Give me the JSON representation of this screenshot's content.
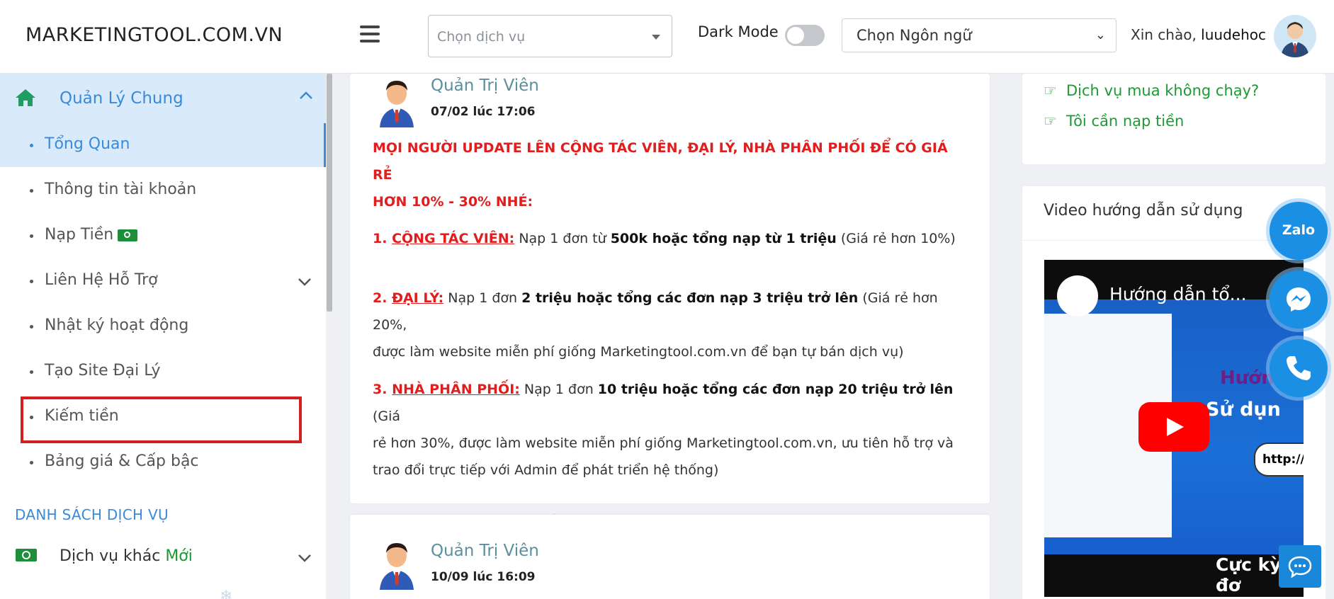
{
  "header": {
    "brand": "MARKETINGTOOL.COM.VN",
    "service_placeholder": "Chọn dịch vụ",
    "dark_mode_label": "Dark Mode",
    "language_value": "Chọn Ngôn ngữ",
    "greeting_prefix": "Xin chào,",
    "username": "luudehoc"
  },
  "sidebar": {
    "group_label": "Quản Lý Chung",
    "items": [
      {
        "label": "Tổng Quan"
      },
      {
        "label": "Thông tin tài khoản"
      },
      {
        "label": "Nạp Tiền"
      },
      {
        "label": "Liên Hệ Hỗ Trợ"
      },
      {
        "label": "Nhật ký hoạt động"
      },
      {
        "label": "Tạo Site Đại Lý"
      },
      {
        "label": "Kiếm tiền"
      },
      {
        "label": "Bảng giá & Cấp bậc"
      }
    ],
    "section_title": "DANH SÁCH DỊCH VỤ",
    "service_label": "Dịch vụ khác",
    "service_badge": "Mới"
  },
  "posts": [
    {
      "author": "Quản Trị Viên",
      "time": "07/02 lúc 17:06",
      "announcement_line1": "MỌI NGƯỜI UPDATE LÊN CỘNG TÁC VIÊN, ĐẠI LÝ, NHÀ PHÂN PHỐI ĐỂ CÓ GIÁ RẺ",
      "announcement_line2": "HƠN 10% - 30% NHÉ:",
      "p1_num": "1. ",
      "p1_label": "CỘNG TÁC VIÊN:",
      "p1_text1": " Nạp 1 đơn từ ",
      "p1_bold": "500k hoặc tổng nạp từ 1 triệu",
      "p1_text2": " (Giá rẻ hơn 10%)",
      "p2_num": "2. ",
      "p2_label": "ĐẠI LÝ:",
      "p2_text1": " Nạp 1 đơn ",
      "p2_bold": "2 triệu hoặc tổng các đơn nạp 3 triệu trở lên",
      "p2_text2": " (Giá rẻ hơn 20%,",
      "p2_line2": "được làm website miễn phí giống Marketingtool.com.vn để bạn tự bán dịch vụ)",
      "p3_num": "3. ",
      "p3_label": "NHÀ PHÂN PHỐI:",
      "p3_text1": " Nạp 1 đơn ",
      "p3_bold": "10 triệu hoặc tổng các đơn nạp 20 triệu trở lên",
      "p3_text2": "  (Giá",
      "p3_line2": "rẻ hơn 30%, được làm website miễn phí giống Marketingtool.com.vn, ưu tiên hỗ trợ và",
      "p3_line3": "trao đổi trực tiếp với Admin để phát triển hệ thống)"
    },
    {
      "author": "Quản Trị Viên",
      "time": "10/09 lúc 16:09"
    }
  ],
  "right": {
    "links": [
      {
        "label": "Dịch vụ mua không chạy?"
      },
      {
        "label": "Tôi cần nạp tiền"
      }
    ],
    "video_card_title": "Video hướng dẫn sử dụng",
    "video_title": "Hướng dẫn tổ...",
    "video_text_1": "Hướng",
    "video_text_2": "Sử dụn",
    "video_text_3": "http://",
    "video_text_4": "Cực kỳ đơ"
  },
  "floating": {
    "zalo_label": "Zalo"
  },
  "colors": {
    "accent": "#3a8ad8",
    "announcement_red": "#e11d1d",
    "link_green": "#1d9a35",
    "highlight_box": "#d21f1f"
  }
}
